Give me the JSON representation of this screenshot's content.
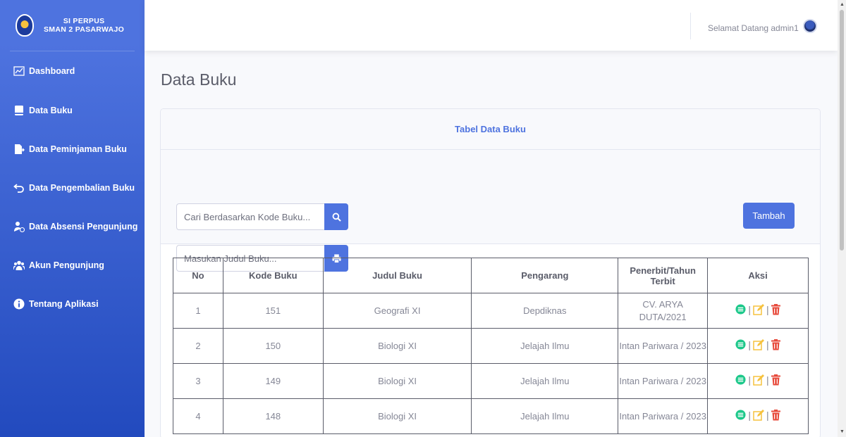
{
  "brand": {
    "line1": "SI PERPUS",
    "line2": "SMAN 2 PASARWAJO"
  },
  "sidebar": {
    "items": [
      {
        "label": "Dashboard",
        "icon": "chart-area-icon"
      },
      {
        "label": "Data Buku",
        "icon": "book-icon"
      },
      {
        "label": "Data Peminjaman Buku",
        "icon": "file-export-icon"
      },
      {
        "label": "Data Pengembalian Buku",
        "icon": "undo-icon"
      },
      {
        "label": "Data Absensi Pengunjung",
        "icon": "user-clock-icon"
      },
      {
        "label": "Akun Pengunjung",
        "icon": "users-icon"
      },
      {
        "label": "Tentang Aplikasi",
        "icon": "info-circle-icon"
      }
    ]
  },
  "topbar": {
    "welcome": "Selamat Datang admin1"
  },
  "page": {
    "title": "Data Buku"
  },
  "card": {
    "header": "Tabel Data Buku"
  },
  "search": {
    "kode_placeholder": "Cari Berdasarkan Kode Buku...",
    "judul_placeholder": "Masukan Judul Buku...",
    "add_label": "Tambah"
  },
  "table": {
    "headers": [
      "No",
      "Kode Buku",
      "Judul Buku",
      "Pengarang",
      "Penerbit/Tahun Terbit",
      "Aksi"
    ],
    "rows": [
      {
        "no": "1",
        "kode": "151",
        "judul": "Geografi XI",
        "pengarang": "Depdiknas",
        "penerbit": "CV. ARYA DUTA/2021"
      },
      {
        "no": "2",
        "kode": "150",
        "judul": "Biologi XI",
        "pengarang": "Jelajah Ilmu",
        "penerbit": "Intan Pariwara / 2023"
      },
      {
        "no": "3",
        "kode": "149",
        "judul": "Biologi XI",
        "pengarang": "Jelajah Ilmu",
        "penerbit": "Intan Pariwara / 2023"
      },
      {
        "no": "4",
        "kode": "148",
        "judul": "Biologi XI",
        "pengarang": "Jelajah Ilmu",
        "penerbit": "Intan Pariwara / 2023"
      }
    ],
    "action_separator": "|"
  },
  "colors": {
    "primary": "#4e73df",
    "success": "#1cc88a",
    "warning": "#f6c23e",
    "danger": "#e74a3b"
  }
}
